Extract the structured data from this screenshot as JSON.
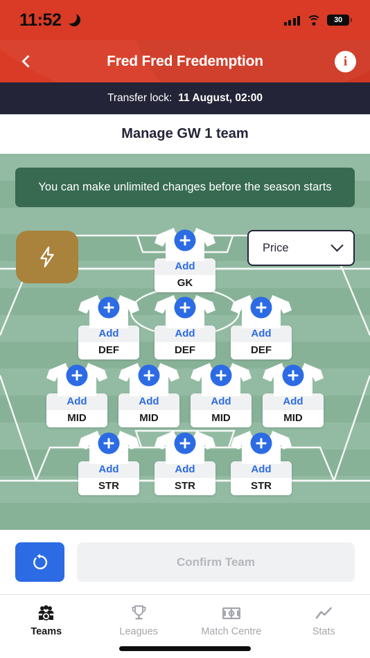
{
  "status_bar": {
    "time": "11:52",
    "moon_icon": "crescent-moon-icon",
    "signal_icon": "cellular-signal-icon",
    "wifi_icon": "wifi-icon",
    "battery_level": "30"
  },
  "header": {
    "back_icon": "chevron-left-icon",
    "title": "Fred Fred Fredemption",
    "info_icon": "info-circle-icon",
    "info_label": "i",
    "background_color": "#D93B26"
  },
  "transfer_lock": {
    "label": "Transfer lock:",
    "value": "11 August, 02:00",
    "background_color": "#242438"
  },
  "page": {
    "title": "Manage GW 1 team"
  },
  "notice": {
    "text": "You can make unlimited changes before the season starts",
    "background_color": "#376A51"
  },
  "pitch": {
    "chip_button": {
      "icon": "lightning-bolt-icon",
      "color": "#A9823C"
    },
    "price_filter": {
      "selected": "Price",
      "chevron_icon": "chevron-down-icon",
      "options": [
        "Price"
      ]
    },
    "add_label": "Add",
    "plus_icon": "plus-icon",
    "shirt_icon": "jersey-icon",
    "accent_color": "#2C6BE4",
    "rows": [
      {
        "position": "GK",
        "count": 1,
        "players": [
          {
            "action": "Add",
            "position": "GK"
          }
        ]
      },
      {
        "position": "DEF",
        "count": 3,
        "players": [
          {
            "action": "Add",
            "position": "DEF"
          },
          {
            "action": "Add",
            "position": "DEF"
          },
          {
            "action": "Add",
            "position": "DEF"
          }
        ]
      },
      {
        "position": "MID",
        "count": 4,
        "players": [
          {
            "action": "Add",
            "position": "MID"
          },
          {
            "action": "Add",
            "position": "MID"
          },
          {
            "action": "Add",
            "position": "MID"
          },
          {
            "action": "Add",
            "position": "MID"
          }
        ]
      },
      {
        "position": "STR",
        "count": 3,
        "players": [
          {
            "action": "Add",
            "position": "STR"
          },
          {
            "action": "Add",
            "position": "STR"
          },
          {
            "action": "Add",
            "position": "STR"
          }
        ]
      }
    ],
    "formation": "1-3-4-3"
  },
  "action_bar": {
    "reset_icon": "reset-circular-arrow-icon",
    "confirm_label": "Confirm Team",
    "confirm_enabled": false
  },
  "tab_bar": {
    "items": [
      {
        "label": "Teams",
        "icon": "team-people-football-icon",
        "active": true
      },
      {
        "label": "Leagues",
        "icon": "trophy-icon",
        "active": false
      },
      {
        "label": "Match Centre",
        "icon": "pitch-icon",
        "active": false
      },
      {
        "label": "Stats",
        "icon": "line-chart-icon",
        "active": false
      }
    ]
  }
}
